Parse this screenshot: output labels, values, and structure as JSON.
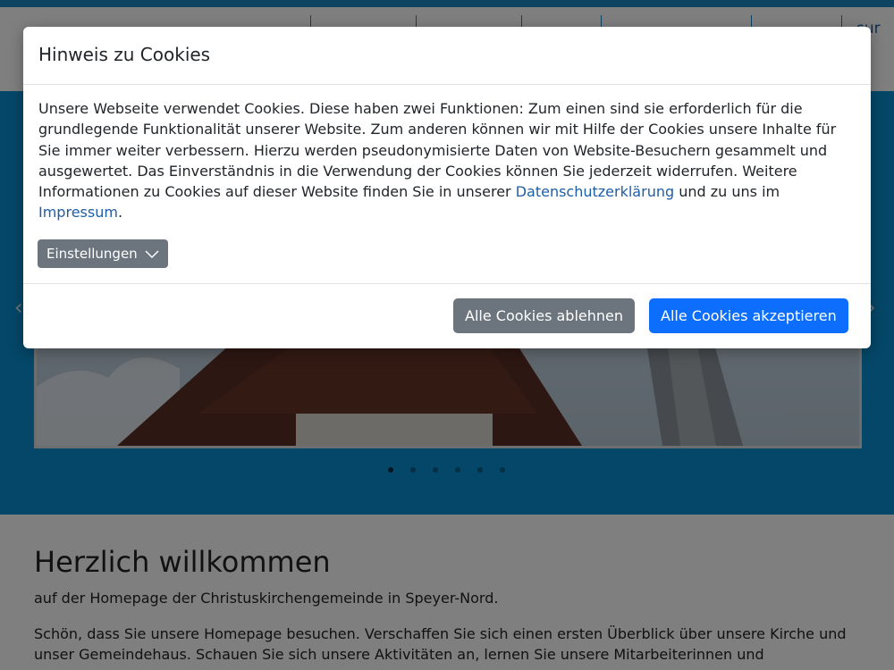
{
  "nav": {
    "partial_text": "sur"
  },
  "hero": {
    "slide_count": 6,
    "active_slide": 1,
    "prev_arrow": "‹",
    "next_arrow": "›"
  },
  "welcome": {
    "title": "Herzlich willkommen",
    "subtitle": "auf der Homepage der Christuskirchengemeinde in Speyer-Nord.",
    "body": "Schön, dass Sie unsere Homepage besuchen. Verschaffen Sie sich einen ersten Überblick über unsere Kirche und unser Gemeindehaus. Schauen Sie sich unsere Aktivitäten an, lernen Sie unsere Mitarbeiterinnen und"
  },
  "cookie_modal": {
    "title": "Hinweis zu Cookies",
    "body_part1": "Unsere Webseite verwendet Cookies. Diese haben zwei Funktionen: Zum einen sind sie erforderlich für die grundlegende Funktionalität unserer Website. Zum anderen können wir mit Hilfe der Cookies unsere Inhalte für Sie immer weiter verbessern. Hierzu werden pseudonymisierte Daten von Website-Besuchern gesammelt und ausgewertet. Das Einverständnis in die Verwendung der Cookies können Sie jederzeit widerrufen. Weitere Informationen zu Cookies auf dieser Website finden Sie in unserer ",
    "privacy_link": "Datenschutzerklärung",
    "body_part2": " und zu uns im ",
    "imprint_link": "Impressum",
    "body_part3": ".",
    "settings_label": "Einstellungen",
    "reject_label": "Alle Cookies ablehnen",
    "accept_label": "Alle Cookies akzeptieren"
  },
  "colors": {
    "primary": "#0d6efd",
    "secondary": "#6c757d",
    "hero_blue": "#0a8fd0",
    "link": "#1d5ea8"
  }
}
